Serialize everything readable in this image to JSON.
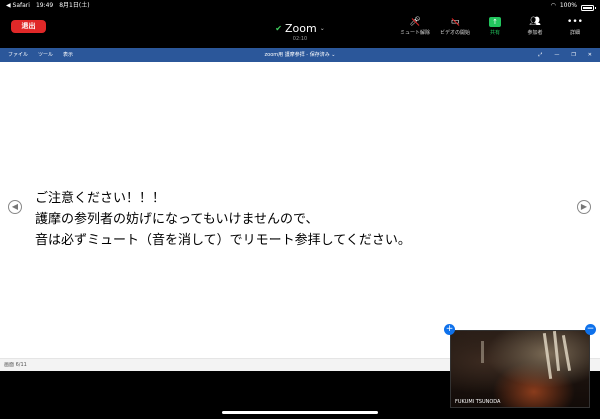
{
  "status": {
    "back_app": "◀ Safari",
    "time": "19:49",
    "date": "8月1日(土)",
    "battery_pct": "100%"
  },
  "toolbar": {
    "leave_label": "退出",
    "meeting_name": "Zoom",
    "timer": "02:10",
    "tools": [
      {
        "label": "ミュート解除",
        "icon": "mic-muted-icon"
      },
      {
        "label": "ビデオの開始",
        "icon": "video-off-icon"
      },
      {
        "label": "共有",
        "icon": "share-screen-icon"
      },
      {
        "label": "参加者",
        "icon": "participants-icon"
      },
      {
        "label": "詳細",
        "icon": "more-icon"
      }
    ]
  },
  "shared_window": {
    "menus": [
      "ファイル",
      "ツール",
      "表示"
    ],
    "doc_title": "zoom用  護摩参拝 - 保存済み ⌄",
    "page_indicator": "画面 6/11"
  },
  "slide": {
    "lines": [
      "ご注意ください！！！",
      "護摩の参列者の妨げになってもいけませんので、",
      "音は必ずミュート（音を消して）でリモート参拝してください。"
    ]
  },
  "video": {
    "participant_name": "FUKUMI TSUNODA"
  },
  "colors": {
    "leave": "#e02828",
    "title_bar": "#2b579a",
    "share": "#22c55e",
    "shield": "#3fcf5e"
  }
}
